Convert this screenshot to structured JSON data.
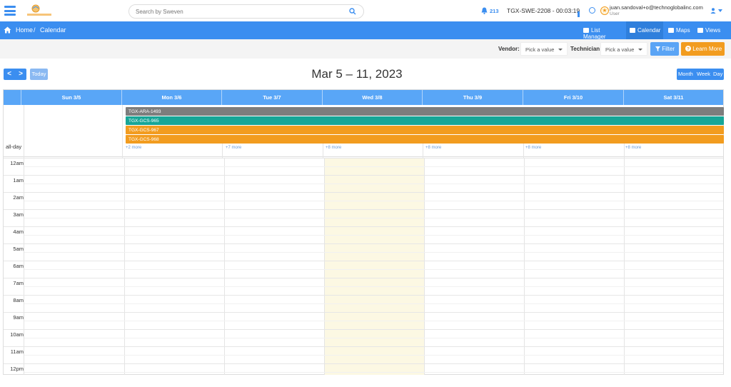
{
  "header": {
    "search_placeholder": "Search by Sweven",
    "notification_count": "213",
    "session": "TGX-SWE-2208 - 00:03:19",
    "user_email": "juan.sandoval+o@technoglobalinc.com",
    "user_role": "User"
  },
  "breadcrumb": {
    "home": "Home",
    "separator": "/",
    "current": "Calendar"
  },
  "nav_views": [
    {
      "label": "List Manager",
      "icon": "list-icon",
      "active": false
    },
    {
      "label": "Calendar",
      "icon": "calendar-icon",
      "active": true
    },
    {
      "label": "Maps",
      "icon": "map-icon",
      "active": false
    },
    {
      "label": "Views",
      "icon": "file-icon",
      "active": false
    }
  ],
  "filters": {
    "vendor_label": "Vendor:",
    "vendor_value": "Pick a value",
    "technician_label": "Technician:",
    "technician_value": "Pick a value",
    "filter_button": "Filter",
    "learn_button": "Learn More"
  },
  "toolbar": {
    "prev": "<",
    "next": ">",
    "today": "Today",
    "title": "Mar 5 – 11, 2023",
    "views": [
      "Month",
      "Week",
      "Day"
    ]
  },
  "calendar": {
    "days": [
      "Sun 3/5",
      "Mon 3/6",
      "Tue 3/7",
      "Wed 3/8",
      "Thu 3/9",
      "Fri 3/10",
      "Sat 3/11"
    ],
    "allday_label": "all-day",
    "events": [
      {
        "label": "TGX-ARA-1493",
        "color": "#7d7d7d"
      },
      {
        "label": "TGX-GCS-965",
        "color": "#17a697"
      },
      {
        "label": "TGX-GCS-967",
        "color": "#f29c1f"
      },
      {
        "label": "TGX-GCS-968",
        "color": "#f29c1f"
      }
    ],
    "more_links": [
      "+2 more",
      "+7 more",
      "+8 more",
      "+8 more",
      "+8 more",
      "+8 more"
    ],
    "hours": [
      "12am",
      "1am",
      "2am",
      "3am",
      "4am",
      "5am",
      "6am",
      "7am",
      "8am",
      "9am",
      "10am",
      "11am",
      "12pm"
    ]
  },
  "colors": {
    "primary": "#3b8ef0",
    "header_blue": "#59a6f7",
    "orange": "#f29c1f",
    "today_bg": "#fcf8e3"
  }
}
